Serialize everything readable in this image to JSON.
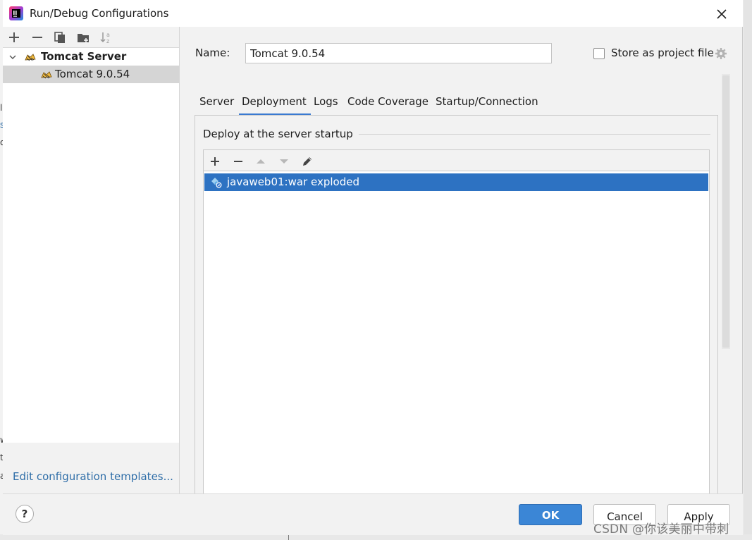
{
  "window": {
    "title": "Run/Debug Configurations",
    "close_icon": "close-icon"
  },
  "sidebar": {
    "toolbar": [
      "add-icon",
      "remove-icon",
      "copy-icon",
      "folder-add-icon",
      "sort-icon"
    ],
    "tree": [
      {
        "label": "Tomcat Server",
        "icon": "tomcat-icon",
        "expanded": true,
        "bold": true
      },
      {
        "label": "Tomcat 9.0.54",
        "icon": "tomcat-icon",
        "selected": true
      }
    ],
    "edit_templates_link": "Edit configuration templates..."
  },
  "config": {
    "name_label": "Name:",
    "name_value": "Tomcat 9.0.54",
    "store_as_project_file": "Store as project file",
    "store_checked": false
  },
  "tabs": [
    {
      "label": "Server"
    },
    {
      "label": "Deployment",
      "active": true
    },
    {
      "label": "Logs"
    },
    {
      "label": "Code Coverage"
    },
    {
      "label": "Startup/Connection"
    }
  ],
  "deployment": {
    "section_title": "Deploy at the server startup",
    "toolbar": [
      "add-icon",
      "remove-icon",
      "move-up-icon",
      "move-down-icon",
      "edit-icon"
    ],
    "items": [
      {
        "label": "javaweb01:war exploded",
        "icon": "artifact-icon",
        "selected": true
      }
    ]
  },
  "footer": {
    "help": "?",
    "ok": "OK",
    "cancel": "Cancel",
    "apply": "Apply"
  },
  "watermark": "CSDN @你该美丽中带刺",
  "colors": {
    "accent": "#3a7ad1",
    "selection": "#2d72c2",
    "ok_button": "#3b86d6",
    "link": "#2f6ea8"
  }
}
